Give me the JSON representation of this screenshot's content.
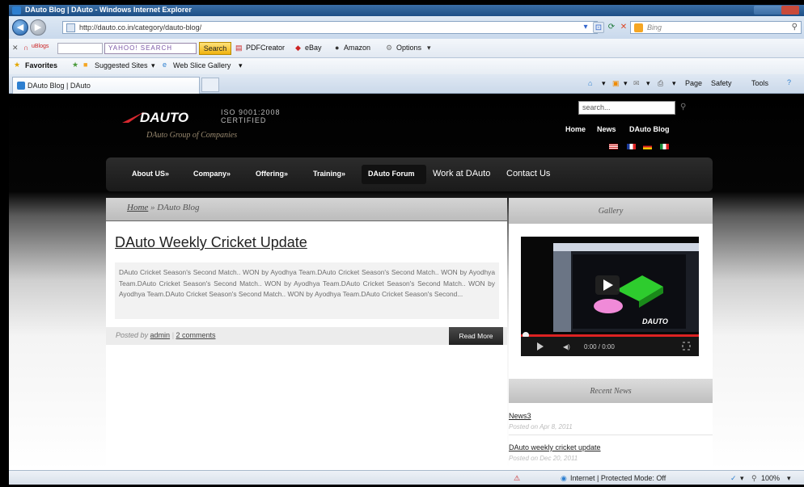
{
  "browser": {
    "window_title": "DAuto Blog | DAuto - Windows Internet Explorer",
    "address": "http://dauto.co.in/category/dauto-blog/",
    "search_engine": "Bing",
    "toolbar": {
      "blog_label": "uBlogs",
      "yahoo_placeholder": "YAHOO! SEARCH",
      "search_button": "Search",
      "pdfcreator": "PDFCreator",
      "ebay": "eBay",
      "amazon": "Amazon",
      "options": "Options"
    },
    "favorites": {
      "favorites_label": "Favorites",
      "suggested_sites": "Suggested Sites",
      "web_slice_gallery": "Web Slice Gallery"
    },
    "tab_title": "DAuto Blog | DAuto",
    "command_bar": {
      "page": "Page",
      "safety": "Safety",
      "tools": "Tools"
    },
    "status": {
      "zone": "Internet | Protected Mode: Off",
      "zoom": "100%"
    }
  },
  "site": {
    "logo_text": "DAUTO",
    "iso_line1": "ISO 9001:2008",
    "iso_line2": "CERTIFIED",
    "tagline": "DAuto Group of Companies",
    "search_placeholder": "search...",
    "top_links": [
      "Home",
      "News",
      "DAuto Blog"
    ],
    "nav": [
      "About US",
      "Company",
      "Offering",
      "Training",
      "DAuto Forum",
      "Work at DAuto",
      "Contact Us"
    ],
    "nav_dropdown_mark": "»",
    "breadcrumb": {
      "home": "Home",
      "separator": " » ",
      "current": "DAuto Blog"
    },
    "post": {
      "title": "DAuto Weekly Cricket Update",
      "excerpt": "DAuto Cricket Season's Second Match.. WON by Ayodhya Team.DAuto Cricket Season's Second Match.. WON by Ayodhya Team.DAuto Cricket Season's Second Match.. WON by Ayodhya Team.DAuto Cricket Season's Second Match.. WON by Ayodhya Team.DAuto Cricket Season's Second Match.. WON by Ayodhya Team.DAuto Cricket Season's Second...",
      "posted_by": "Posted by",
      "author": "admin",
      "comments": "2 comments",
      "read_more": "Read More"
    },
    "sidebar": {
      "gallery_title": "Gallery",
      "video_time": "0:00 / 0:00",
      "recent_title": "Recent News",
      "news": [
        {
          "title": "News3",
          "date": "Posted on Apr 8, 2011"
        },
        {
          "title": "DAuto weekly cricket update",
          "date": "Posted on Dec 20, 2011"
        }
      ]
    }
  }
}
